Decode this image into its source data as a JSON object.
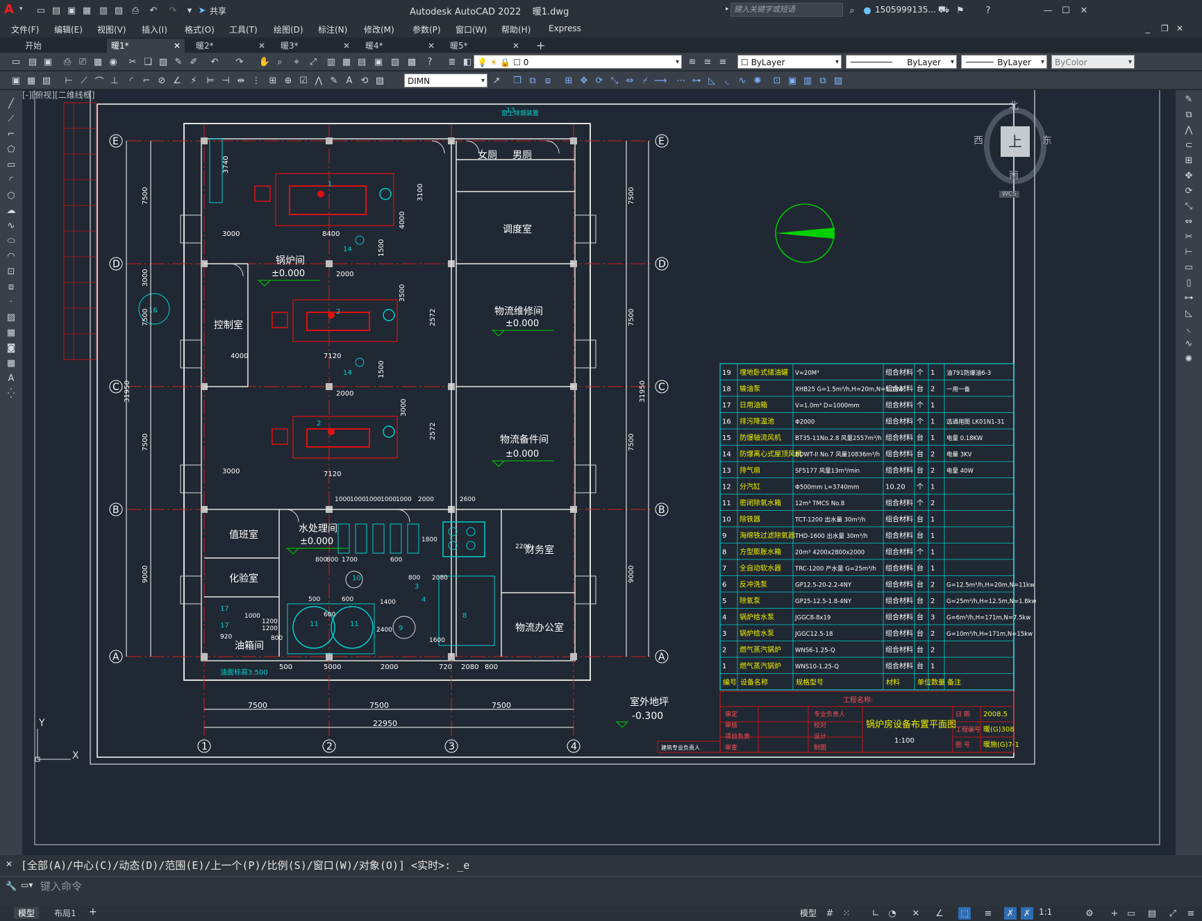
{
  "app": {
    "window_title": "Autodesk AutoCAD 2022",
    "document_name": "暖1.dwg",
    "share_label": "共享",
    "search_placeholder": "键入关键字或短语",
    "user_name": "1505999135...",
    "logo_letter": "A"
  },
  "menus": [
    "文件(F)",
    "编辑(E)",
    "视图(V)",
    "插入(I)",
    "格式(O)",
    "工具(T)",
    "绘图(D)",
    "标注(N)",
    "修改(M)",
    "参数(P)",
    "窗口(W)",
    "帮助(H)",
    "Express"
  ],
  "tabs": [
    {
      "label": "开始",
      "active": false
    },
    {
      "label": "暖1*",
      "active": true
    },
    {
      "label": "暖2*",
      "active": false
    },
    {
      "label": "暖3*",
      "active": false
    },
    {
      "label": "暖4*",
      "active": false
    },
    {
      "label": "暖5*",
      "active": false
    }
  ],
  "toolbar": {
    "layer_value": "0",
    "color_value": "ByLayer",
    "linetype_value": "ByLayer",
    "lineweight_value": "ByLayer",
    "plotstyle_value": "ByColor",
    "dimstyle_value": "DIMN"
  },
  "viewport": {
    "label": "[-][俯视][二维线框]",
    "viewcube": {
      "north": "北",
      "south": "南",
      "east": "东",
      "west": "西",
      "top": "上",
      "wcs": "WCS"
    },
    "ucs": {
      "x": "X",
      "y": "Y"
    }
  },
  "drawing": {
    "grid_letters": [
      "E",
      "D",
      "C",
      "B",
      "A"
    ],
    "grid_numbers": [
      "1",
      "2",
      "3",
      "4"
    ],
    "rooms": [
      {
        "name": "女厕",
        "kind": "small"
      },
      {
        "name": "男厕",
        "kind": "small"
      },
      {
        "name": "调度室",
        "kind": "room"
      },
      {
        "name": "锅炉间",
        "kind": "room"
      },
      {
        "name": "物流维修间",
        "kind": "room"
      },
      {
        "name": "控制室",
        "kind": "room"
      },
      {
        "name": "物流备件间",
        "kind": "room"
      },
      {
        "name": "值班室",
        "kind": "room"
      },
      {
        "name": "水处理间",
        "kind": "room"
      },
      {
        "name": "化验室",
        "kind": "room"
      },
      {
        "name": "财务室",
        "kind": "room"
      },
      {
        "name": "物流办公室",
        "kind": "room"
      },
      {
        "name": "油箱间",
        "kind": "room"
      }
    ],
    "levels": [
      "±0.000",
      "±0.000",
      "±0.000",
      "±0.000"
    ],
    "outdoor_label": "室外地坪",
    "outdoor_level": "-0.300",
    "oil_level": "油面标高3.500",
    "dims_bottom": [
      "7500",
      "7500",
      "7500"
    ],
    "dim_total": "22950",
    "dims_sub": [
      "500",
      "5000",
      "2000",
      "720",
      "2080",
      "800"
    ],
    "dims_left": [
      "7500",
      "3000",
      "7500",
      "7500",
      "9000"
    ],
    "dim_left_total": "31950",
    "dims_right": [
      "7500",
      "7500",
      "7500",
      "9000"
    ],
    "dim_right_total": "31950",
    "boiler_dims": [
      "8400",
      "7120",
      "7120",
      "3000",
      "4000",
      "3000",
      "2000",
      "2000",
      "3740",
      "3100",
      "2572",
      "2572",
      "4000",
      "3500",
      "1500",
      "1500",
      "3000"
    ],
    "tank_dims": [
      "1000",
      "1000",
      "1000",
      "1000",
      "1000",
      "2000",
      "2600",
      "1800",
      "2200",
      "800",
      "800",
      "1700",
      "600",
      "800",
      "2080",
      "1400",
      "1200",
      "2400",
      "1600",
      "600",
      "920",
      "1200",
      "800",
      "1000",
      "500",
      "600"
    ],
    "marks": [
      "13",
      "14",
      "14",
      "16",
      "1",
      "2",
      "2",
      "7",
      "8",
      "9",
      "10",
      "11",
      "11",
      "17",
      "17",
      "3",
      "4"
    ],
    "marks_tag": "窗上排烟装置"
  },
  "equipment_table": {
    "headers": [
      "编号",
      "设备名称",
      "规格型号",
      "材料",
      "单位",
      "数量",
      "备注"
    ],
    "rows": [
      [
        "19",
        "埋地卧式储油罐",
        "V=20M³",
        "组合材料",
        "个",
        "1",
        "油791防爆油6-3"
      ],
      [
        "18",
        "输油泵",
        "XHB25  G=1.5m³/h,H=20m,N=1.1kw",
        "组合材料",
        "台",
        "2",
        "一用一备"
      ],
      [
        "17",
        "日用油箱",
        "V=1.0m³  D=1000mm",
        "组合材料",
        "个",
        "1",
        ""
      ],
      [
        "16",
        "排污降温池",
        "Φ2000",
        "组合材料",
        "个",
        "1",
        "选通用图 LK01N1-31"
      ],
      [
        "15",
        "防爆轴流风机",
        "BT35-11No.2.8  风量2557m³/h",
        "组合材料",
        "台",
        "1",
        "电量 0.18KW"
      ],
      [
        "14",
        "防爆离心式屋顶风机",
        "BDWT-II No.7  风量10836m³/h",
        "组合材料",
        "台",
        "2",
        "电量 3KV"
      ],
      [
        "13",
        "排气扇",
        "SF5177  风量13m³/min",
        "组合材料",
        "台",
        "2",
        "电量 40W"
      ],
      [
        "12",
        "分汽缸",
        "Φ500mm   L=3740mm",
        "10.20",
        "个",
        "1",
        ""
      ],
      [
        "11",
        "密闭除氧水箱",
        "12m³   TMCS No.8",
        "组合材料",
        "个",
        "2",
        ""
      ],
      [
        "10",
        "除铁器",
        "TCT-1200  出水量 30m³/h",
        "组合材料",
        "台",
        "1",
        ""
      ],
      [
        "9",
        "海绵铁过滤除氧器",
        "THD-1600  出水量 30m³/h",
        "组合材料",
        "台",
        "1",
        ""
      ],
      [
        "8",
        "方型膨胀水箱",
        "20m³   4200x2800x2000",
        "组合材料",
        "个",
        "1",
        ""
      ],
      [
        "7",
        "全自动软水器",
        "TRC-1200   产水量 G=25m³/h",
        "组合材料",
        "台",
        "1",
        ""
      ],
      [
        "6",
        "反冲洗泵",
        "GP12.5-20-2.2-4NY",
        "组合材料",
        "台",
        "2",
        "G=12.5m³/h,H=20m,N=11kw"
      ],
      [
        "5",
        "除氧泵",
        "GP25-12.5-1.8-4NY",
        "组合材料",
        "台",
        "2",
        "G=25m³/h,H=12.5m,N=1.8kw"
      ],
      [
        "4",
        "锅炉给水泵",
        "JGGC8-8x19",
        "组合材料",
        "台",
        "3",
        "G=6m³/h,H=171m,N=7.5kw"
      ],
      [
        "3",
        "锅炉给水泵",
        "JGGC12.5-18",
        "组合材料",
        "台",
        "2",
        "G=10m³/h,H=171m,N=15kw"
      ],
      [
        "2",
        "燃气蒸汽锅炉",
        "WNS6-1.25-Q",
        "组合材料",
        "台",
        "2",
        ""
      ],
      [
        "1",
        "燃气蒸汽锅炉",
        "WNS10-1.25-Q",
        "组合材料",
        "台",
        "1",
        ""
      ]
    ]
  },
  "title_block": {
    "project_label": "工程名称:",
    "drawing_title": "锅炉房设备布置平面图",
    "scale": "1:100",
    "roles": [
      "审定",
      "审核",
      "项目负责",
      "审查"
    ],
    "roles2": [
      "专业负责人",
      "校对",
      "设计",
      "制图"
    ],
    "date_label": "日 期",
    "date_value": "2008.5",
    "number_label": "工程编号",
    "number_value": "暖(G)308",
    "sheet_label": "图 号",
    "sheet_value": "暖施(G)7-1",
    "stamp_label": "建筑专业负责人"
  },
  "command": {
    "history": "[全部(A)/中心(C)/动态(D)/范围(E)/上一个(P)/比例(S)/窗口(W)/对象(O)] <实时>: _e",
    "placeholder": "键入命令"
  },
  "status": {
    "tabs": [
      "模型",
      "布局1"
    ],
    "model_label": "模型",
    "scale": "1:1"
  }
}
